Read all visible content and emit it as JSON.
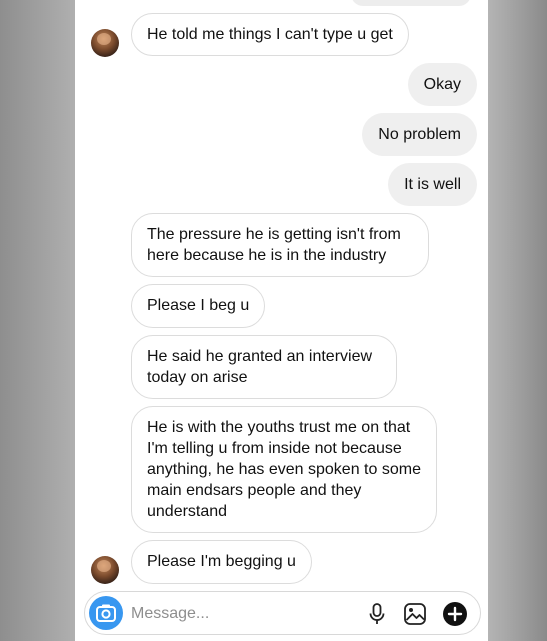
{
  "thread": {
    "messages": [
      {
        "direction": "in",
        "text": "He told me things I can't type u get"
      },
      {
        "direction": "out",
        "text": "Okay"
      },
      {
        "direction": "out",
        "text": "No problem"
      },
      {
        "direction": "out",
        "text": "It is well"
      },
      {
        "direction": "in",
        "text": "The pressure he is getting isn't from here because he is in the industry"
      },
      {
        "direction": "in",
        "text": "Please I beg u"
      },
      {
        "direction": "in",
        "text": "He said he granted an interview today on arise"
      },
      {
        "direction": "in",
        "text": "He is with the youths trust me on that I'm telling u from inside not because anything, he has even spoken to some main endsars people and they understand"
      },
      {
        "direction": "in",
        "text": "Please I'm begging u"
      }
    ]
  },
  "composer": {
    "placeholder": "Message...",
    "icons": [
      "camera-icon",
      "microphone-icon",
      "gallery-icon",
      "add-icon"
    ]
  },
  "colors": {
    "accent": "#3897f0",
    "outgoing_bubble": "#efefef",
    "incoming_border": "#dcdcdc"
  }
}
